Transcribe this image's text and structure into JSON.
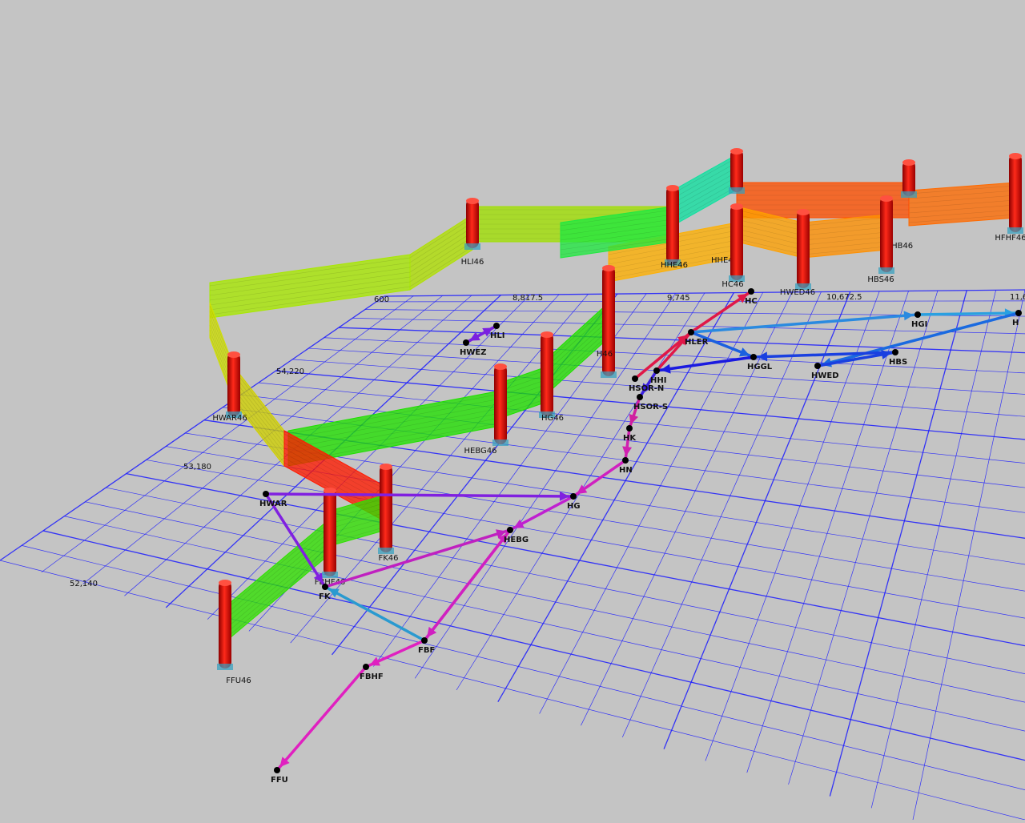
{
  "background_color": "#c4c4c4",
  "grid": {
    "line_color": "#1a1aff",
    "x_labels": [
      "8,817.5",
      "9,745",
      "10,672.5",
      "11,6"
    ],
    "y_labels": [
      "54,220",
      "53,180",
      "52,140"
    ],
    "x_partial_label": "600"
  },
  "nodes": [
    {
      "id": "HC",
      "label": "HC"
    },
    {
      "id": "HLER",
      "label": "HLER"
    },
    {
      "id": "HGI",
      "label": "HGI"
    },
    {
      "id": "H",
      "label": "H"
    },
    {
      "id": "HGGL",
      "label": "HGGL"
    },
    {
      "id": "HWED",
      "label": "HWED"
    },
    {
      "id": "HBS",
      "label": "HBS"
    },
    {
      "id": "HLI",
      "label": "HLI"
    },
    {
      "id": "HWEZ",
      "label": "HWEZ"
    },
    {
      "id": "HSOR-N",
      "label": "HSOR-N"
    },
    {
      "id": "HHI",
      "label": "HHI"
    },
    {
      "id": "HSOR-S",
      "label": "HSOR-S"
    },
    {
      "id": "HK",
      "label": "HK"
    },
    {
      "id": "HN",
      "label": "HN"
    },
    {
      "id": "HG",
      "label": "HG"
    },
    {
      "id": "HEBG",
      "label": "HEBG"
    },
    {
      "id": "HWAR",
      "label": "HWAR"
    },
    {
      "id": "FK",
      "label": "FK"
    },
    {
      "id": "FBF",
      "label": "FBF"
    },
    {
      "id": "FBHF",
      "label": "FBHF"
    },
    {
      "id": "FFU",
      "label": "FFU"
    }
  ],
  "edges": [
    {
      "from": "HLER",
      "to": "HC",
      "color": "#e01848"
    },
    {
      "from": "HHI",
      "to": "HLER",
      "color": "#e01848"
    },
    {
      "from": "HSOR-N",
      "to": "HLER",
      "color": "#e01848"
    },
    {
      "from": "HLER",
      "to": "HGI",
      "color": "#2a8ae0"
    },
    {
      "from": "HGI",
      "to": "H",
      "color": "#2aa0e0"
    },
    {
      "from": "H",
      "to": "HWED",
      "color": "#1a6ae0"
    },
    {
      "from": "HLER",
      "to": "HGGL",
      "color": "#1a60e0"
    },
    {
      "from": "HBS",
      "to": "HGGL",
      "color": "#1a40e0"
    },
    {
      "from": "HWED",
      "to": "HBS",
      "color": "#1a40e0"
    },
    {
      "from": "HGGL",
      "to": "HHI",
      "color": "#1a1ae0"
    },
    {
      "from": "HHI",
      "to": "HSOR-S",
      "color": "#3a20e0"
    },
    {
      "from": "HLI",
      "to": "HWEZ",
      "color": "#7a20e0"
    },
    {
      "from": "HWEZ",
      "to": "HLI",
      "color": "#7a20e0"
    },
    {
      "from": "HSOR-S",
      "to": "HK",
      "color": "#d020a0"
    },
    {
      "from": "HK",
      "to": "HN",
      "color": "#d020b0"
    },
    {
      "from": "HN",
      "to": "HG",
      "color": "#d020c0"
    },
    {
      "from": "HG",
      "to": "HEBG",
      "color": "#c020d0"
    },
    {
      "from": "FK",
      "to": "HEBG",
      "color": "#c020c0"
    },
    {
      "from": "HEBG",
      "to": "FBF",
      "color": "#d020c0"
    },
    {
      "from": "FBF",
      "to": "HEBG",
      "color": "#d020c0"
    },
    {
      "from": "FBF",
      "to": "FBHF",
      "color": "#e020c0"
    },
    {
      "from": "FBHF",
      "to": "FFU",
      "color": "#e020c0"
    },
    {
      "from": "FBF",
      "to": "FK",
      "color": "#2a9ad0"
    },
    {
      "from": "HWAR",
      "to": "HG",
      "color": "#8020e0"
    },
    {
      "from": "HWAR",
      "to": "FK",
      "color": "#8020e0"
    }
  ],
  "towers": [
    {
      "label": "HFHF46"
    },
    {
      "label": "HFHB46"
    },
    {
      "label": "HHE46"
    },
    {
      "label": "HHE46"
    },
    {
      "label": "HLI46"
    },
    {
      "label": "HC46"
    },
    {
      "label": "HWED46"
    },
    {
      "label": "HBS46"
    },
    {
      "label": "H46"
    },
    {
      "label": "HEBG46"
    },
    {
      "label": "HG46"
    },
    {
      "label": "HWAR46"
    },
    {
      "label": "FK46"
    },
    {
      "label": "FBHF46"
    },
    {
      "label": "FFU46"
    }
  ]
}
